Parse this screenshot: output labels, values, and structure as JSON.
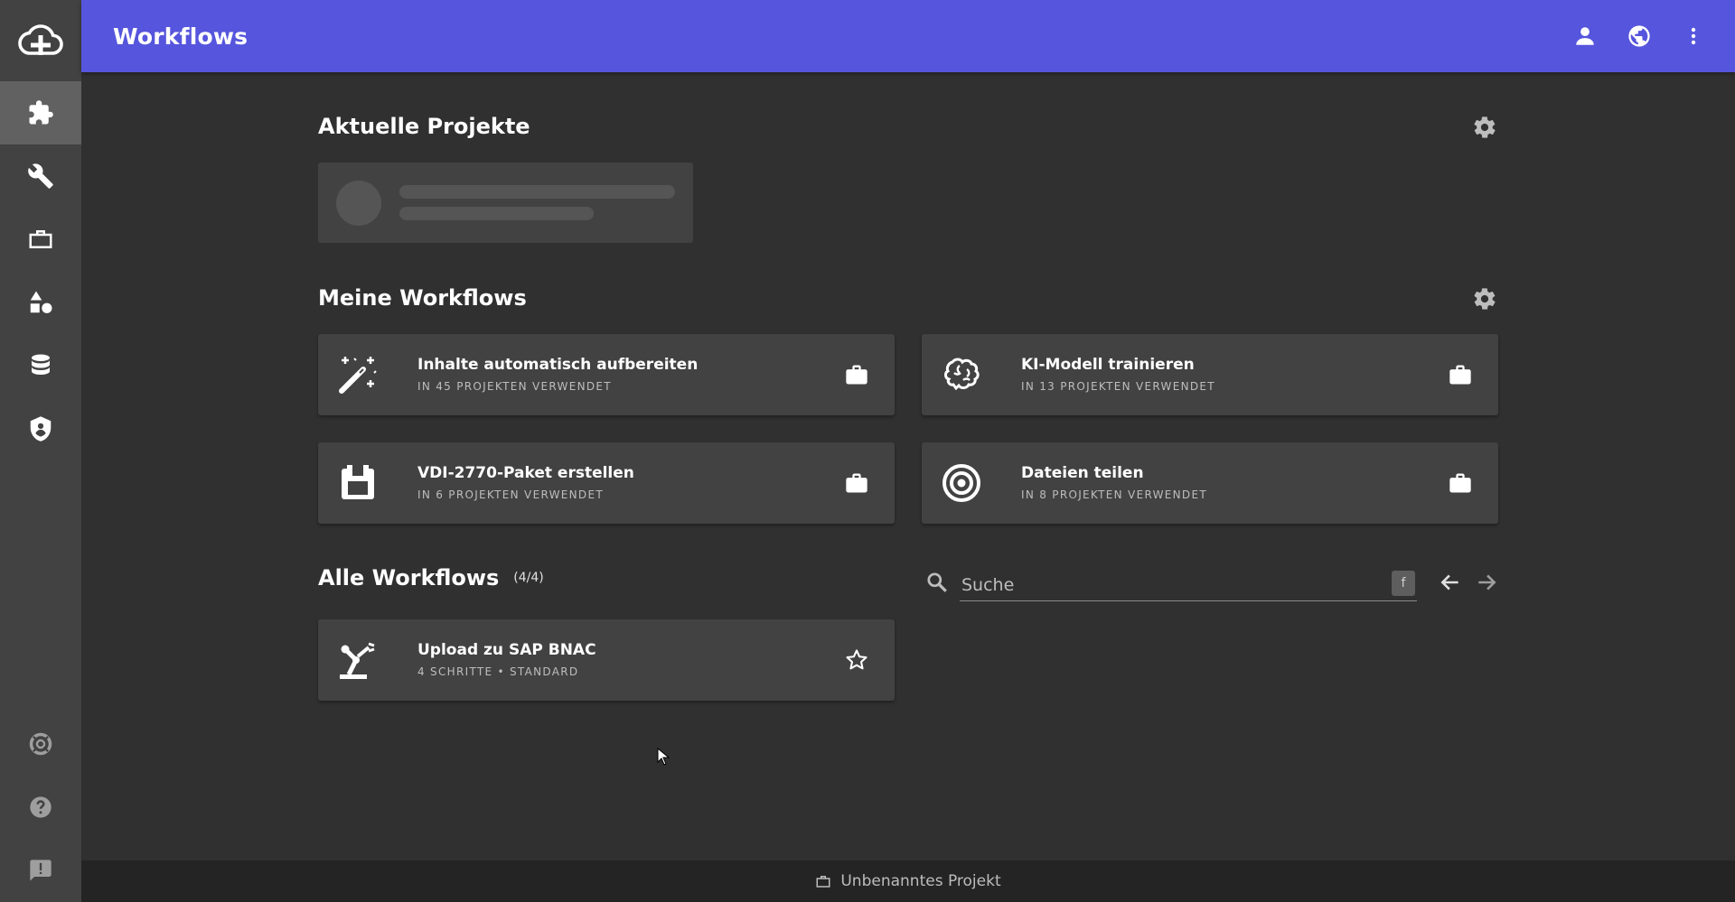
{
  "topbar": {
    "title": "Workflows",
    "accent": "#5555dd",
    "actions": [
      {
        "icon": "person-icon"
      },
      {
        "icon": "globe-icon"
      },
      {
        "icon": "more-vertical-icon"
      }
    ]
  },
  "sidebar": {
    "logo_icon": "cloud-add-icon",
    "items": [
      {
        "icon": "puzzle-icon",
        "active": true
      },
      {
        "icon": "wrench-icon"
      },
      {
        "icon": "briefcase-icon"
      },
      {
        "icon": "shapes-icon"
      },
      {
        "icon": "database-icon"
      },
      {
        "icon": "shield-icon"
      }
    ],
    "bottom_items": [
      {
        "icon": "lifebuoy-icon"
      },
      {
        "icon": "help-icon"
      },
      {
        "icon": "feedback-icon"
      }
    ]
  },
  "recent": {
    "title": "Aktuelle Projekte"
  },
  "my_workflows": {
    "title": "Meine Workflows",
    "cards": [
      {
        "title": "Inhalte automatisch aufbereiten",
        "subtitle": "IN 45 PROJEKTEN VERWENDET",
        "icon": "magic-wand-icon",
        "action_icon": "briefcase-icon"
      },
      {
        "title": "KI-Modell trainieren",
        "subtitle": "IN 13 PROJEKTEN VERWENDET",
        "icon": "brain-icon",
        "action_icon": "briefcase-icon"
      },
      {
        "title": "VDI-2770-Paket erstellen",
        "subtitle": "IN 6 PROJEKTEN VERWENDET",
        "icon": "package-icon",
        "action_icon": "briefcase-icon"
      },
      {
        "title": "Dateien teilen",
        "subtitle": "IN 8 PROJEKTEN VERWENDET",
        "icon": "target-icon",
        "action_icon": "briefcase-icon"
      }
    ]
  },
  "all_workflows": {
    "title": "Alle Workflows",
    "count": "(4/4)",
    "search_placeholder": "Suche",
    "search_value": "",
    "kbd_hint": "f",
    "cards": [
      {
        "title": "Upload zu SAP BNAC",
        "subtitle": "4 SCHRITTE • STANDARD",
        "icon": "robot-arm-icon",
        "action_icon": "star-outline-icon"
      }
    ]
  },
  "footer": {
    "project_name": "Unbenanntes Projekt",
    "icon": "briefcase-outline-icon"
  }
}
